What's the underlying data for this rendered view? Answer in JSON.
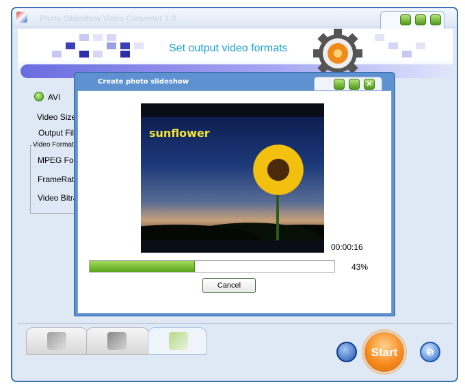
{
  "window": {
    "title": "Photo Slideshow Video Converter 1.0"
  },
  "banner": {
    "title": "Set output video formats"
  },
  "left_panel": {
    "format_option": "AVI",
    "video_size_label": "Video Size",
    "output_file_label": "Output Fil",
    "video_format_group": "Video Format",
    "mpeg_format_label": "MPEG Forr",
    "framerate_label": "FrameRate",
    "video_bitrate_label": "Video Bitra"
  },
  "dialog": {
    "title": "Create photo slideshow",
    "photo_caption": "sunflower",
    "time": "00:00:16",
    "progress_percent": 43,
    "progress_label": "43%",
    "cancel_label": "Cancel"
  },
  "bottom": {
    "tabs": [
      "photos-tab",
      "music-tab",
      "output-tab"
    ],
    "start_label": "Start"
  },
  "colors": {
    "accent_blue": "#5e91cf",
    "progress_green": "#5aa51c",
    "start_orange": "#f78b1f",
    "banner_text": "#1ba0d8"
  }
}
